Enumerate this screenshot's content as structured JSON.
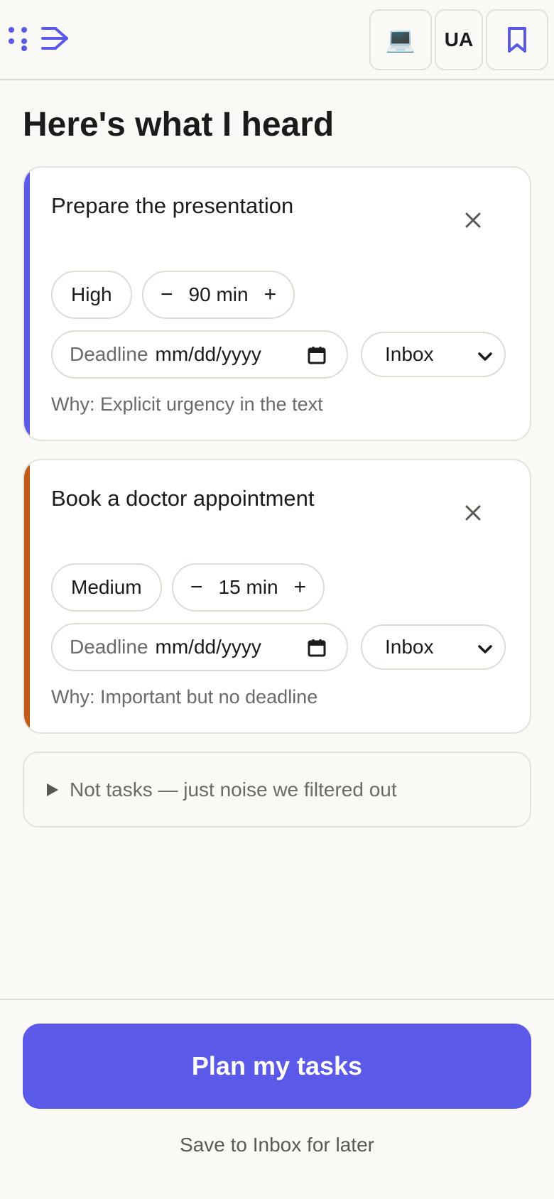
{
  "header": {
    "device_glyph": "💻",
    "language": "UA",
    "icons": [
      "logo-dots-icon",
      "logo-arrow-icon",
      "laptop-icon",
      "bookmark-icon"
    ]
  },
  "page": {
    "title": "Here's what I heard"
  },
  "tasks": [
    {
      "title": "Prepare the presentation",
      "priority": "High",
      "duration": "90 min",
      "deadline_label": "Deadline",
      "deadline_value": "mm/dd/yyyy",
      "list": "Inbox",
      "why": "Why: Explicit urgency in the text",
      "accent": "#5b5ae8"
    },
    {
      "title": "Book a doctor appointment",
      "priority": "Medium",
      "duration": "15 min",
      "deadline_label": "Deadline",
      "deadline_value": "mm/dd/yyyy",
      "list": "Inbox",
      "why": "Why: Important but no deadline",
      "accent": "#c05a17"
    }
  ],
  "controls": {
    "minus": "−",
    "plus": "+"
  },
  "noise": {
    "label": "Not tasks — just noise we filtered out"
  },
  "footer": {
    "primary_label": "Plan my tasks",
    "secondary_label": "Save to Inbox for later"
  },
  "colors": {
    "accent": "#5b5ae8",
    "medium_accent": "#c05a17",
    "background": "#faf9f6"
  }
}
